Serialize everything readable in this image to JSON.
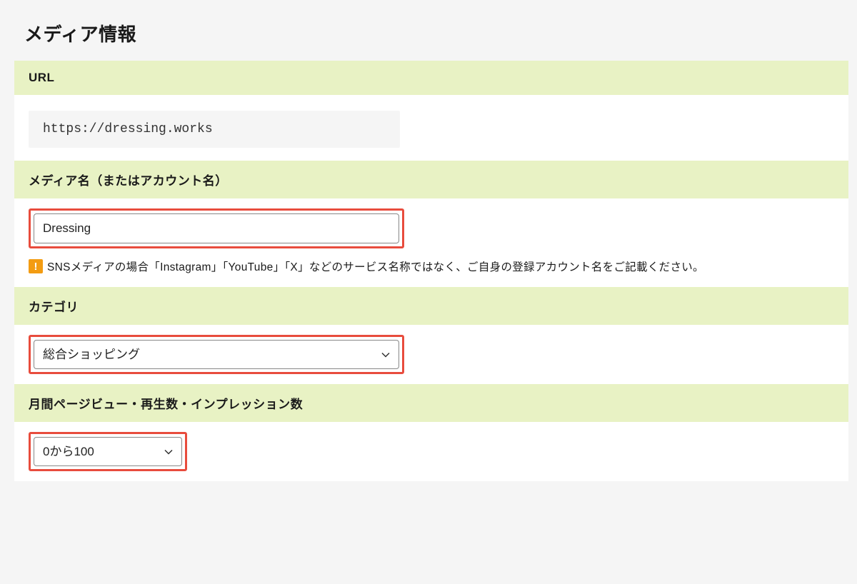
{
  "section": {
    "title": "メディア情報"
  },
  "url_field": {
    "label": "URL",
    "value": "https://dressing.works"
  },
  "media_name_field": {
    "label": "メディア名（またはアカウント名）",
    "value": "Dressing",
    "note": "SNSメディアの場合「Instagram」「YouTube」「X」などのサービス名称ではなく、ご自身の登録アカウント名をご記載ください。"
  },
  "category_field": {
    "label": "カテゴリ",
    "selected": "総合ショッピング"
  },
  "pageview_field": {
    "label": "月間ページビュー・再生数・インプレッション数",
    "selected": "0から100"
  }
}
